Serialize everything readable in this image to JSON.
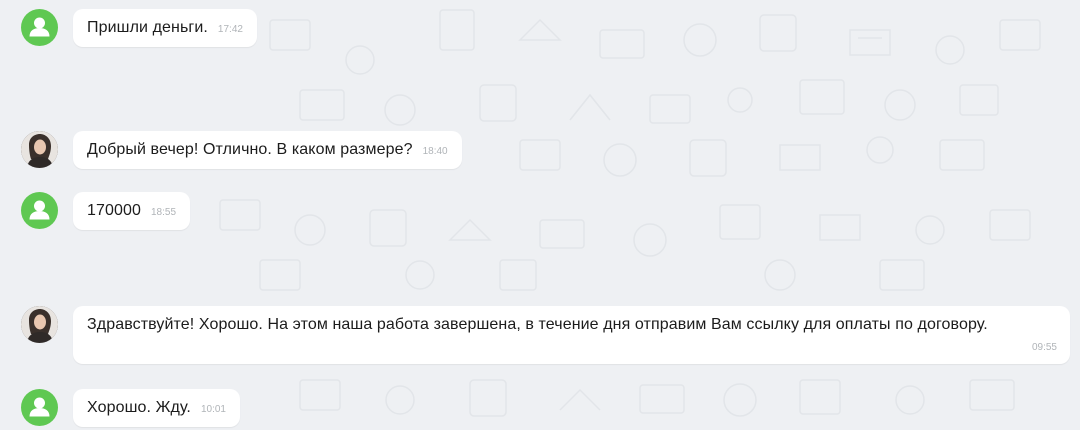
{
  "colors": {
    "background": "#eef0f3",
    "bubble": "#ffffff",
    "user_avatar": "#5fc852",
    "time_text": "#b0b4b8"
  },
  "messages": [
    {
      "sender": "client",
      "avatar_icon": "person-icon",
      "text": "Пришли деньги.",
      "time": "17:42"
    },
    {
      "sender": "agent",
      "avatar_icon": "agent-photo",
      "text": "Добрый вечер! Отлично. В каком размере?",
      "time": "18:40"
    },
    {
      "sender": "client",
      "avatar_icon": "person-icon",
      "text": "170000",
      "time": "18:55"
    },
    {
      "sender": "agent",
      "avatar_icon": "agent-photo",
      "text": "Здравствуйте! Хорошо. На этом наша работа завершена, в течение дня отправим Вам ссылку для оплаты по договору.",
      "time": "09:55"
    },
    {
      "sender": "client",
      "avatar_icon": "person-icon",
      "text": "Хорошо. Жду.",
      "time": "10:01"
    }
  ]
}
